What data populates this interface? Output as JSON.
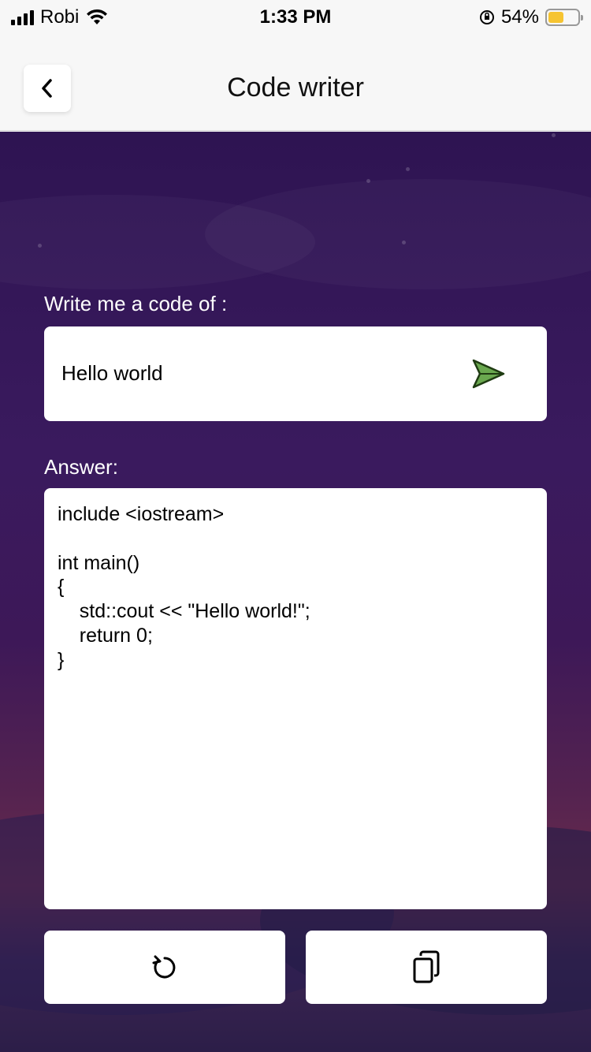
{
  "status_bar": {
    "carrier": "Robi",
    "time": "1:33 PM",
    "battery_percent": "54%",
    "battery_level": 0.54,
    "battery_color": "#f6c431"
  },
  "nav": {
    "title": "Code writer",
    "back_icon": "chevron-left-icon"
  },
  "prompt": {
    "label": "Write me a code of :",
    "value": "Hello world",
    "send_icon": "send-icon",
    "send_color": "#6aa84f"
  },
  "answer": {
    "label": "Answer:",
    "code": "include <iostream>\n\nint main()\n{\n    std::cout << \"Hello world!\";\n    return 0;\n}"
  },
  "actions": {
    "reset_icon": "refresh-icon",
    "copy_icon": "copy-icon"
  },
  "colors": {
    "background_top": "#2e1452",
    "background_mid": "#3d1858",
    "background_glow": "#6a2c4c"
  }
}
